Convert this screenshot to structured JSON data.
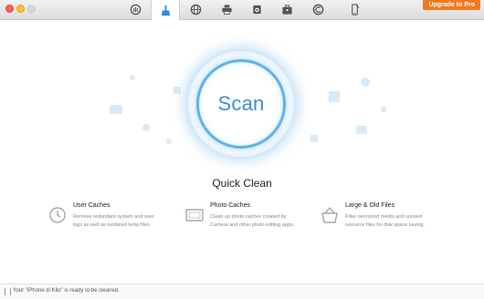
{
  "toolbar": {
    "tools": [
      {
        "name": "fingerprint-icon",
        "active": false
      },
      {
        "name": "broom-icon",
        "active": true
      },
      {
        "name": "globe-icon",
        "active": false
      },
      {
        "name": "printer-icon",
        "active": false
      },
      {
        "name": "camera-icon",
        "active": false
      },
      {
        "name": "toolbox-icon",
        "active": false
      },
      {
        "name": "backup-icon",
        "active": false
      },
      {
        "name": "iphone-icon",
        "active": false
      }
    ],
    "upgrade_label": "Upgrade to Pro"
  },
  "scan": {
    "label": "Scan"
  },
  "section": {
    "title": "Quick Clean"
  },
  "features": [
    {
      "title": "User Caches",
      "description": "Remove redundant system and user logs as well as outdated temp files.",
      "icon": "info-clock-icon"
    },
    {
      "title": "Photo Caches",
      "description": "Clean up photo caches created by Camera and other photo editing apps.",
      "icon": "photo-frame-icon"
    },
    {
      "title": "Large & Old Files",
      "description": "Filter oversized media and unused resource files for disk space saving.",
      "icon": "basket-icon"
    }
  ],
  "status": {
    "text": "Your \"iPhone di Kilo\" is ready to be cleaned."
  },
  "colors": {
    "accent": "#5fb3ea",
    "upgrade": "#f07a22"
  }
}
